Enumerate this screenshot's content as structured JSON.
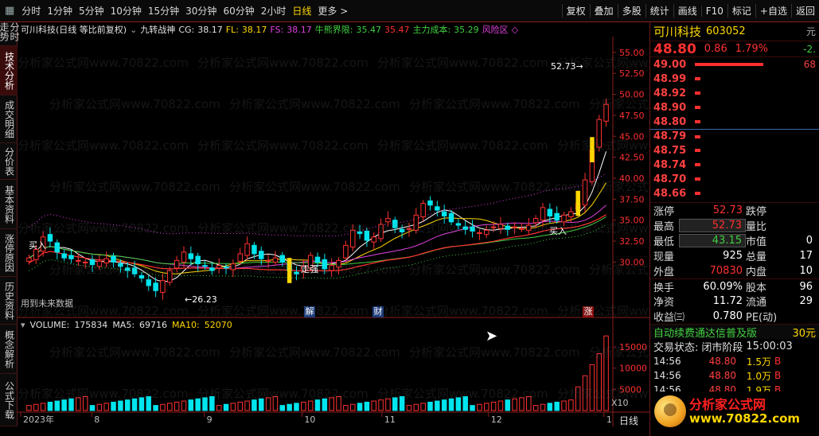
{
  "toolbar": {
    "icons": [
      "menu-grid-icon"
    ],
    "tabs": [
      "分时",
      "1分钟",
      "5分钟",
      "10分钟",
      "15分钟",
      "30分钟",
      "60分钟",
      "2小时",
      "日线",
      "更多"
    ],
    "active_tab": "日线",
    "more_arrow": ">",
    "buttons": [
      "复权",
      "叠加",
      "多股",
      "统计",
      "画线",
      "F10",
      "标记",
      "+自选",
      "返回"
    ]
  },
  "left_nav": {
    "items": [
      "分时走势",
      "技术分析",
      "成交明细",
      "分价表",
      "基本资料",
      "涨停原因",
      "历史资料",
      "概念解析",
      "公式下载"
    ],
    "active": "技术分析"
  },
  "chart_header": {
    "stock": "可川科技(日线 等比前复权)",
    "indicator": "九转战神",
    "cg_label": "CG:",
    "cg_value": "38.17",
    "fl_label": "FL:",
    "fl_value": "38.17",
    "fs_label": "FS:",
    "fs_value": "38.17",
    "bull_label": "牛熊界限:",
    "bull_value": "35.47",
    "v5_value": "35.47",
    "main_cost_label": "主力成本:",
    "main_cost_value": "35.29",
    "risk_label": "风险区"
  },
  "volume_header": {
    "volume_label": "VOLUME:",
    "volume_value": "175834",
    "ma5_label": "MA5:",
    "ma5_value": "69716",
    "ma10_label": "MA10:",
    "ma10_value": "52070"
  },
  "chart_annotations": {
    "high_label": "52.73",
    "low_label": "26.23",
    "buy_text": "买入",
    "strong_text": "走强",
    "future_text": "用到未来数据",
    "jie_marker": "解",
    "cai_marker": "财",
    "zhang_marker": "涨",
    "x10": "X10",
    "period": "日线",
    "year_label": "2023年"
  },
  "chart_data": {
    "type": "line",
    "price_axis": [
      55.0,
      52.5,
      50.0,
      47.5,
      45.0,
      42.5,
      40.0,
      37.5,
      35.0,
      32.5,
      30.0
    ],
    "price_axis_labels": [
      "55.00",
      "52.50",
      "50.00",
      "47.50",
      "45.00",
      "42.50",
      "40.00",
      "37.50",
      "35.00",
      "32.50",
      "30.00"
    ],
    "volume_axis_labels": [
      "15000",
      "10000",
      "5000"
    ],
    "volume_axis": [
      15000,
      10000,
      5000
    ],
    "volume_unit": "X10",
    "x_labels": [
      "2023年",
      "8",
      "9",
      "10",
      "11",
      "12",
      "1"
    ],
    "close_series": [
      30.5,
      31.5,
      33,
      32.5,
      31.2,
      30.5,
      30.4,
      30.2,
      30.0,
      29.7,
      30.1,
      30.4,
      30.0,
      29.5,
      29.0,
      28.6,
      28.1,
      27.2,
      26.6,
      27.8,
      29.0,
      30.2,
      31.2,
      30.4,
      29.8,
      29.5,
      29.0,
      29.6,
      29.3,
      29.8,
      31.0,
      32.2,
      31.0,
      30.4,
      30.2,
      30.5,
      30.0,
      29.0,
      28.6,
      29.5,
      30.8,
      30.0,
      29.2,
      29.6,
      30.2,
      32.0,
      33.8,
      33.4,
      32.6,
      33.0,
      34.5,
      35.2,
      34.1,
      33.6,
      34.0,
      35.6,
      37.0,
      36.8,
      36.2,
      35.5,
      34.8,
      34.4,
      33.9,
      33.7,
      33.5,
      33.8,
      34.2,
      34.5,
      33.9,
      34.2,
      34.0,
      34.4,
      35.2,
      36.5,
      35.5,
      35.0,
      35.6,
      36.0,
      37.0,
      39.8,
      43.4,
      47.0,
      48.8
    ]
  },
  "quote_panel": {
    "name": "可川科技",
    "code": "603052",
    "unit_label": "元",
    "change_rate_side": "-2.",
    "price": "48.80",
    "change": "0.86",
    "change_pct": "1.79%",
    "orderbook": [
      {
        "price": "49.00",
        "bar": 0.66,
        "vol": "68"
      },
      {
        "price": "48.99",
        "bar": 0.05,
        "vol": ""
      },
      {
        "price": "48.92",
        "bar": 0.05,
        "vol": ""
      },
      {
        "price": "48.90",
        "bar": 0.05,
        "vol": ""
      },
      {
        "price": "48.80",
        "bar": 0.05,
        "vol": ""
      },
      {
        "price": "48.79",
        "bar": 0.05,
        "vol": ""
      },
      {
        "price": "48.75",
        "bar": 0.05,
        "vol": ""
      },
      {
        "price": "48.74",
        "bar": 0.05,
        "vol": ""
      },
      {
        "price": "48.70",
        "bar": 0.05,
        "vol": ""
      },
      {
        "price": "48.66",
        "bar": 0.05,
        "vol": ""
      }
    ],
    "stats": [
      {
        "l1": "涨停",
        "v1": "52.73",
        "l2": "跌停",
        "v2": ""
      },
      {
        "l1": "最高",
        "v1": "52.73",
        "l2": "量比",
        "v2": ""
      },
      {
        "l1": "最低",
        "v1": "43.15",
        "l2": "市值",
        "v2": "0"
      },
      {
        "l1": "现量",
        "v1": "925",
        "l2": "总量",
        "v2": "17"
      },
      {
        "l1": "外盘",
        "v1": "70830",
        "l2": "内盘",
        "v2": "10"
      },
      {
        "l1": "换手",
        "v1": "60.09%",
        "l2": "股本",
        "v2": "96"
      },
      {
        "l1": "净资",
        "v1": "11.72",
        "l2": "流通",
        "v2": "29"
      },
      {
        "l1": "收益㈢",
        "v1": "0.780",
        "l2": "PE(动)",
        "v2": ""
      }
    ],
    "promo_text": "自动续费通达信普及版",
    "promo_price": "30元",
    "status_label": "交易状态:",
    "status_value": "闭市阶段",
    "status_time": "15:00:03",
    "ticks": [
      {
        "time": "14:56",
        "price": "48.80",
        "vol": "1.5万",
        "dir": "B"
      },
      {
        "time": "14:56",
        "price": "48.80",
        "vol": "1.0万",
        "dir": "B"
      },
      {
        "time": "14:56",
        "price": "48.80",
        "vol": "1.9万",
        "dir": "B"
      }
    ]
  },
  "branding": {
    "logo_text": "分析家公式网",
    "logo_url": "www.70822.com",
    "watermark": "分析家公式网www.70822.com"
  },
  "colors": {
    "up": "#ff3030",
    "down": "#00e5ee",
    "yellow": "#ffd700",
    "magenta": "#e040e0",
    "green": "#40d040"
  }
}
